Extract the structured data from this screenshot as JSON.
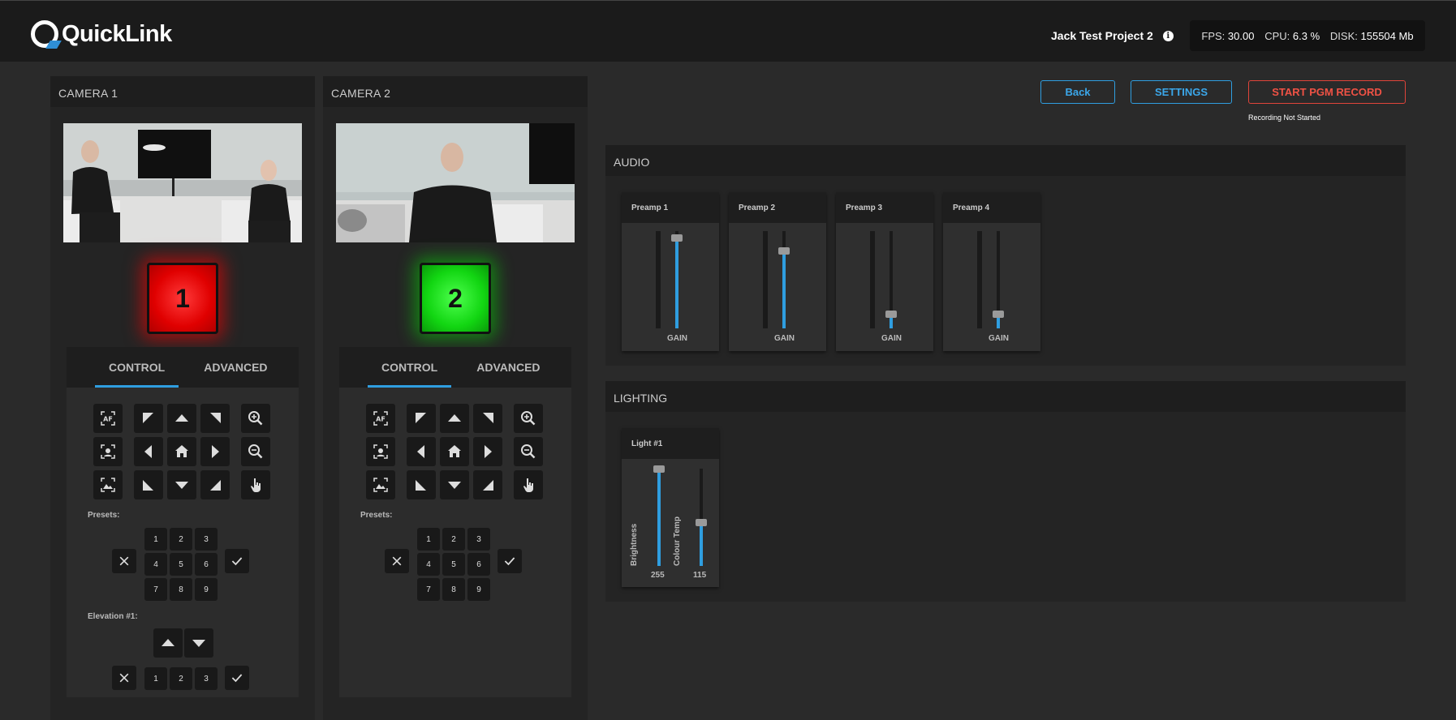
{
  "header": {
    "logo_text": "QuickLink",
    "project_name": "Jack Test Project 2",
    "fps_label": "FPS:",
    "fps_value": "30.00",
    "cpu_label": "CPU:",
    "cpu_value": "6.3 %",
    "disk_label": "DISK:",
    "disk_value": "155504 Mb"
  },
  "cameras": [
    {
      "title": "CAMERA 1",
      "tally_number": "1",
      "tally_color": "#ff0000",
      "tabs": [
        "CONTROL",
        "ADVANCED"
      ],
      "active_tab": "CONTROL",
      "presets_label": "Presets:",
      "presets": [
        "1",
        "2",
        "3",
        "4",
        "5",
        "6",
        "7",
        "8",
        "9"
      ],
      "elevation_label": "Elevation #1:",
      "elevation_presets": [
        "1",
        "2",
        "3"
      ]
    },
    {
      "title": "CAMERA 2",
      "tally_number": "2",
      "tally_color": "#00ff00",
      "tabs": [
        "CONTROL",
        "ADVANCED"
      ],
      "active_tab": "CONTROL",
      "presets_label": "Presets:",
      "presets": [
        "1",
        "2",
        "3",
        "4",
        "5",
        "6",
        "7",
        "8",
        "9"
      ]
    }
  ],
  "controls": {
    "back_label": "Back",
    "settings_label": "SETTINGS",
    "record_label": "START PGM RECORD",
    "record_status": "Recording Not Started"
  },
  "audio": {
    "title": "AUDIO",
    "gain_label": "GAIN",
    "channels": [
      {
        "name": "Preamp 1",
        "level": 0.93
      },
      {
        "name": "Preamp 2",
        "level": 0.8
      },
      {
        "name": "Preamp 3",
        "level": 0.15
      },
      {
        "name": "Preamp 4",
        "level": 0.15
      }
    ]
  },
  "lighting": {
    "title": "LIGHTING",
    "light": {
      "name": "Light #1",
      "brightness_label": "Brightness",
      "brightness_value": "255",
      "brightness_level": 1.0,
      "colour_temp_label": "Colour Temp",
      "colour_temp_value": "115",
      "colour_temp_level": 0.45
    }
  },
  "colors": {
    "accent": "#2f9ee0",
    "record_red": "#f05245",
    "background": "#2a2a2a"
  }
}
